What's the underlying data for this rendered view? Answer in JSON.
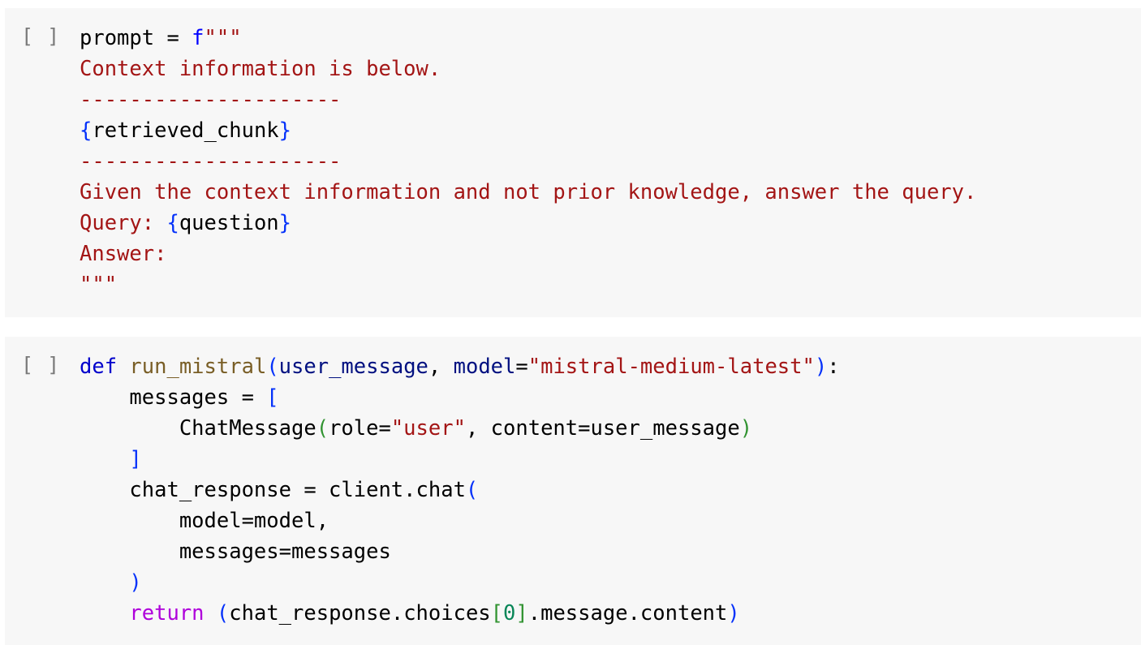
{
  "cells": [
    {
      "run_indicator": "[ ]",
      "lines": [
        [
          {
            "t": "prompt = ",
            "c": "plain"
          },
          {
            "t": "f",
            "c": "kw"
          },
          {
            "t": "\"\"\"",
            "c": "str"
          }
        ],
        [
          {
            "t": "Context information is below.",
            "c": "str"
          }
        ],
        [
          {
            "t": "---------------------",
            "c": "str"
          }
        ],
        [
          {
            "t": "{",
            "c": "br1"
          },
          {
            "t": "retrieved_chunk",
            "c": "plain"
          },
          {
            "t": "}",
            "c": "br1"
          }
        ],
        [
          {
            "t": "---------------------",
            "c": "str"
          }
        ],
        [
          {
            "t": "Given the context information and not prior knowledge, answer the query.",
            "c": "str"
          }
        ],
        [
          {
            "t": "Query: ",
            "c": "str"
          },
          {
            "t": "{",
            "c": "br1"
          },
          {
            "t": "question",
            "c": "plain"
          },
          {
            "t": "}",
            "c": "br1"
          }
        ],
        [
          {
            "t": "Answer:",
            "c": "str"
          }
        ],
        [
          {
            "t": "\"\"\"",
            "c": "str"
          }
        ]
      ]
    },
    {
      "run_indicator": "[ ]",
      "lines": [
        [
          {
            "t": "def ",
            "c": "kw2"
          },
          {
            "t": "run_mistral",
            "c": "fn"
          },
          {
            "t": "(",
            "c": "br1"
          },
          {
            "t": "user_message",
            "c": "param"
          },
          {
            "t": ", ",
            "c": "plain"
          },
          {
            "t": "model",
            "c": "param"
          },
          {
            "t": "=",
            "c": "plain"
          },
          {
            "t": "\"mistral-medium-latest\"",
            "c": "str"
          },
          {
            "t": ")",
            "c": "br1"
          },
          {
            "t": ":",
            "c": "plain"
          }
        ],
        [
          {
            "t": "    messages = ",
            "c": "plain"
          },
          {
            "t": "[",
            "c": "br1"
          }
        ],
        [
          {
            "t": "        ChatMessage",
            "c": "plain"
          },
          {
            "t": "(",
            "c": "br2"
          },
          {
            "t": "role=",
            "c": "plain"
          },
          {
            "t": "\"user\"",
            "c": "str"
          },
          {
            "t": ", content=user_message",
            "c": "plain"
          },
          {
            "t": ")",
            "c": "br2"
          }
        ],
        [
          {
            "t": "    ",
            "c": "plain"
          },
          {
            "t": "]",
            "c": "br1"
          }
        ],
        [
          {
            "t": "    chat_response = client.chat",
            "c": "plain"
          },
          {
            "t": "(",
            "c": "br1"
          }
        ],
        [
          {
            "t": "        model=model,",
            "c": "plain"
          }
        ],
        [
          {
            "t": "        messages=messages",
            "c": "plain"
          }
        ],
        [
          {
            "t": "    ",
            "c": "plain"
          },
          {
            "t": ")",
            "c": "br1"
          }
        ],
        [
          {
            "t": "    ",
            "c": "plain"
          },
          {
            "t": "return",
            "c": "ret"
          },
          {
            "t": " ",
            "c": "plain"
          },
          {
            "t": "(",
            "c": "br1"
          },
          {
            "t": "chat_response.choices",
            "c": "plain"
          },
          {
            "t": "[",
            "c": "br2"
          },
          {
            "t": "0",
            "c": "num"
          },
          {
            "t": "]",
            "c": "br2"
          },
          {
            "t": ".message.content",
            "c": "plain"
          },
          {
            "t": ")",
            "c": "br1"
          }
        ]
      ]
    }
  ],
  "colors": {
    "cell_background": "#f7f7f7",
    "keyword": "#0000ff",
    "string": "#a31515",
    "function": "#795e26",
    "parameter": "#001080",
    "return_keyword": "#af00db",
    "bracket_blue": "#0431fa",
    "bracket_green": "#319331",
    "number": "#098658"
  }
}
